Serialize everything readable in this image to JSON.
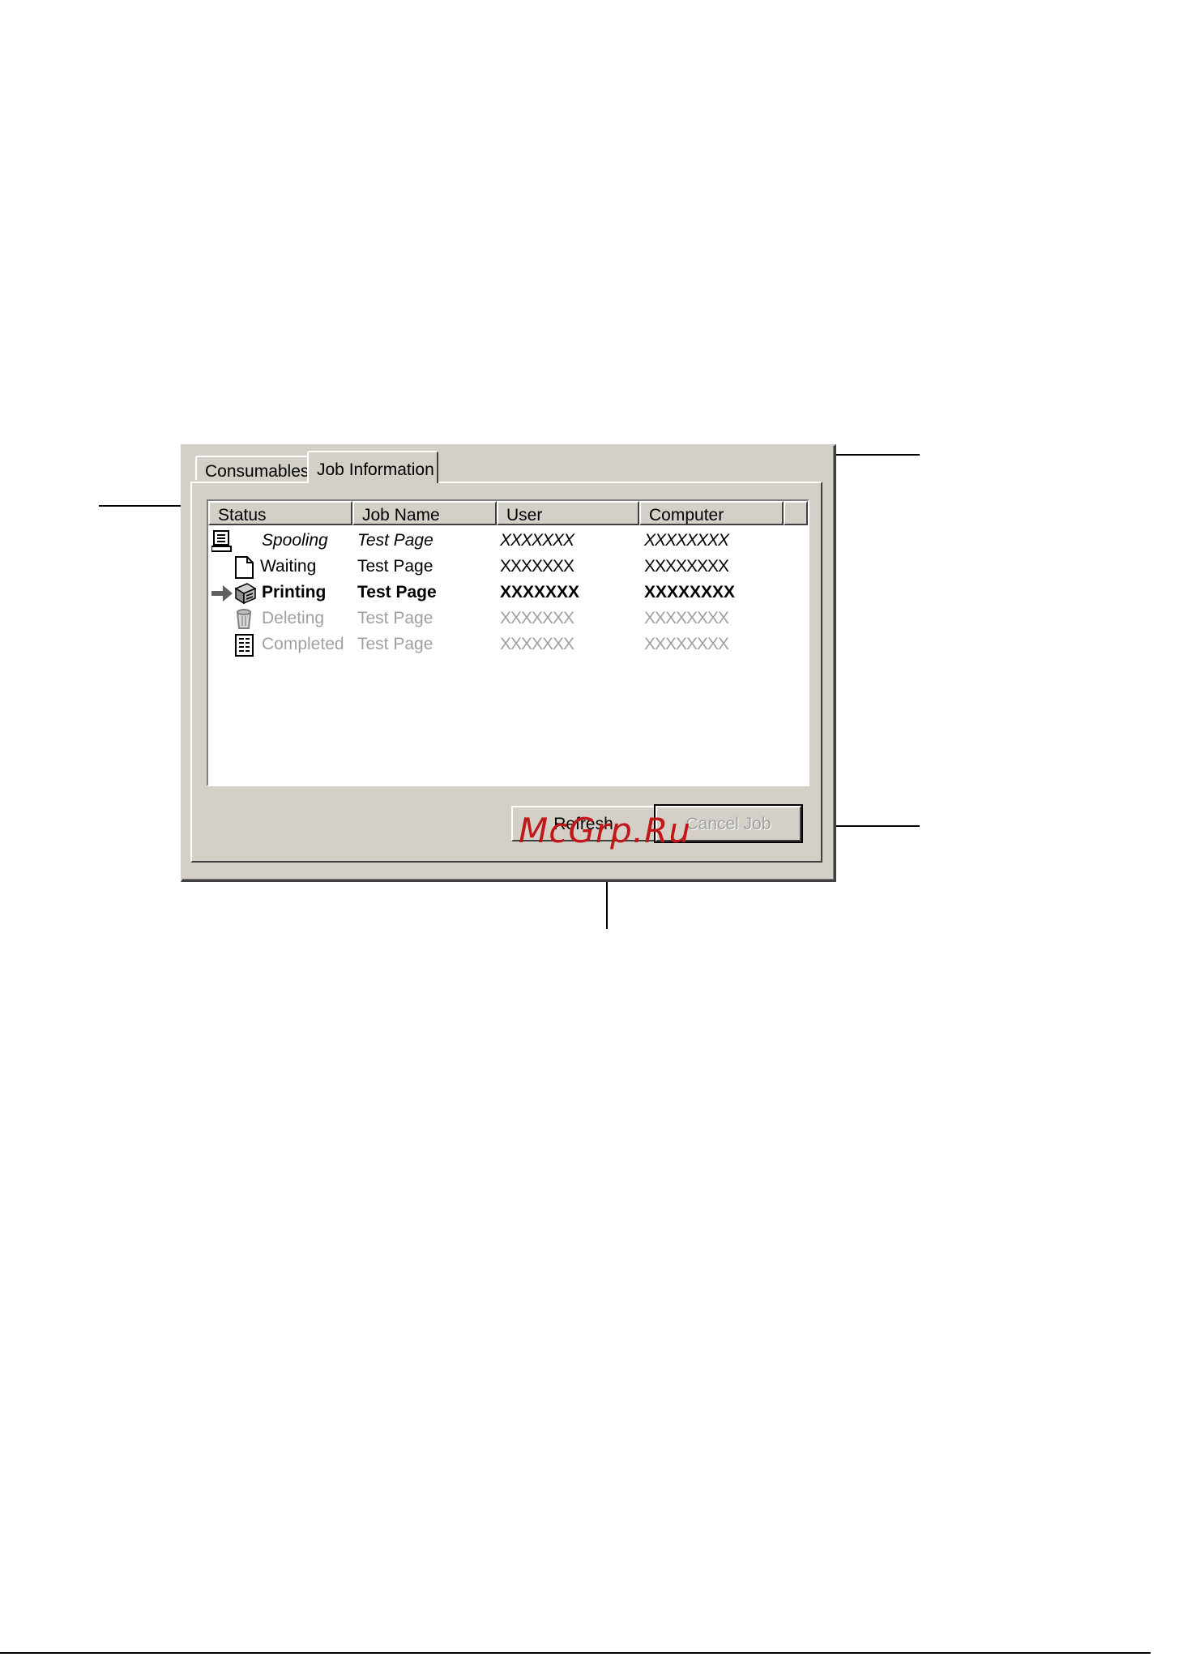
{
  "dialog": {
    "tabs": [
      {
        "label": "Consumables",
        "active": false
      },
      {
        "label": "Job Information",
        "active": true
      }
    ],
    "list": {
      "columns": [
        "Status",
        "Job Name",
        "User",
        "Computer"
      ],
      "rows": [
        {
          "status": "Spooling",
          "job_name": "Test Page",
          "user": "XXXXXXX",
          "computer": "XXXXXXXX",
          "icon": "spooling-computer-icon"
        },
        {
          "status": "Waiting",
          "job_name": "Test Page",
          "user": "XXXXXXX",
          "computer": "XXXXXXXX",
          "icon": "document-page-icon"
        },
        {
          "status": "Printing",
          "job_name": "Test Page",
          "user": "XXXXXXX",
          "computer": "XXXXXXXX",
          "icon": "printer-icon"
        },
        {
          "status": "Deleting",
          "job_name": "Test Page",
          "user": "XXXXXXX",
          "computer": "XXXXXXXX",
          "icon": "trash-icon"
        },
        {
          "status": "Completed",
          "job_name": "Test Page",
          "user": "XXXXXXX",
          "computer": "XXXXXXXX",
          "icon": "completed-document-icon"
        }
      ]
    },
    "buttons": {
      "refresh": "Refresh",
      "cancel_job": "Cancel Job"
    }
  },
  "watermark": "McGrp.Ru",
  "colors": {
    "dialog_bg": "#d4d0c8",
    "disabled_text": "#a0a0a0",
    "watermark": "#c01818"
  }
}
